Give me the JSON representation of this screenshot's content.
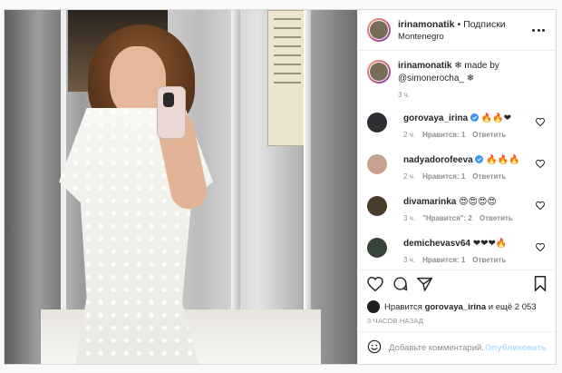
{
  "post": {
    "username": "irinamonatik",
    "dot": "•",
    "follow_label": "Подписки",
    "location": "Montenegro",
    "more_icon": "more-horizontal-icon"
  },
  "caption": {
    "username": "irinamonatik",
    "emoji": "❄",
    "text": "made by",
    "mention": "@simonerocha_",
    "emoji2": "❄",
    "time": "3 ч."
  },
  "comments": [
    {
      "username": "gorovaya_irina",
      "verified": true,
      "text": "🔥🔥❤",
      "time": "2 ч.",
      "likes": "Нравится: 1",
      "reply": "Ответить",
      "avatar_color": "#2e2f33"
    },
    {
      "username": "nadyadorofeeva",
      "verified": true,
      "text": "🔥🔥🔥",
      "time": "2 ч.",
      "likes": "Нравится: 1",
      "reply": "Ответить",
      "avatar_color": "#c4a28d"
    },
    {
      "username": "divamarinka",
      "verified": false,
      "text": "😍😍😍😍",
      "time": "3 ч.",
      "likes": "\"Нравится\": 2",
      "reply": "Ответить",
      "avatar_color": "#4a3a2c"
    },
    {
      "username": "demichevasv64",
      "verified": false,
      "text": "❤❤❤🔥",
      "time": "3 ч.",
      "likes": "Нравится: 1",
      "reply": "Ответить",
      "avatar_color": "#37443a"
    }
  ],
  "likes": {
    "prefix": "Нравится",
    "user": "gorovaya_irina",
    "suffix": "и ещё 2 053"
  },
  "timestamp": "3 ЧАСОВ НАЗАД",
  "add_comment": {
    "placeholder": "Добавьте комментарий...",
    "post_label": "Опубликовать"
  },
  "colors": {
    "text": "#262626",
    "muted": "#8e8e8e",
    "verified": "#3897f0",
    "post_disabled": "#b2dffc",
    "border": "#dbdbdb"
  }
}
